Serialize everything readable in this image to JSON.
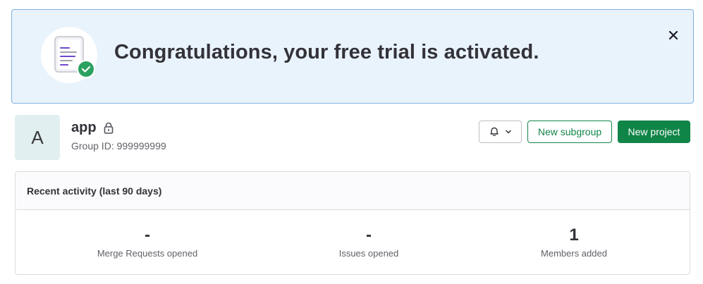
{
  "banner": {
    "message": "Congratulations, your free trial is activated.",
    "close_label": "×"
  },
  "group": {
    "avatar_letter": "A",
    "name": "app",
    "id_text": "Group ID: 999999999"
  },
  "actions": {
    "new_subgroup": "New subgroup",
    "new_project": "New project"
  },
  "activity": {
    "title": "Recent activity (last 90 days)",
    "stats": [
      {
        "value": "-",
        "label": "Merge Requests opened"
      },
      {
        "value": "-",
        "label": "Issues opened"
      },
      {
        "value": "1",
        "label": "Members added"
      }
    ]
  },
  "colors": {
    "banner_bg": "#e9f3fc",
    "banner_border": "#7eb2e0",
    "primary_green": "#108548",
    "success_badge": "#2da160",
    "avatar_bg": "#e1eff0"
  }
}
